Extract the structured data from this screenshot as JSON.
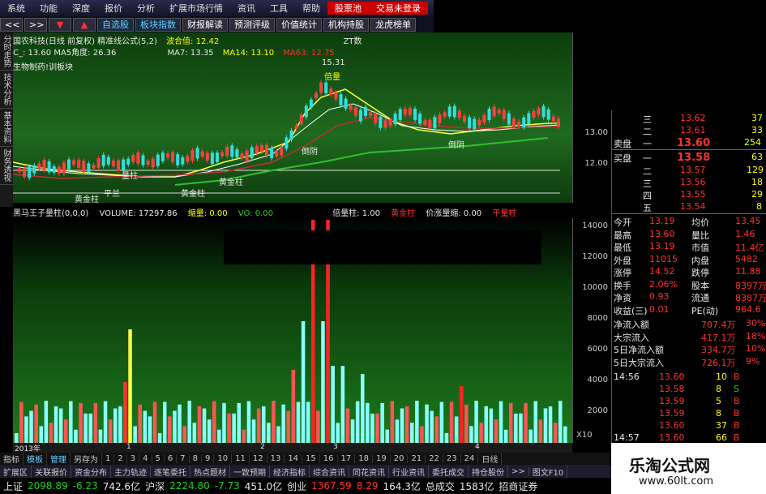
{
  "menu": [
    "系统",
    "功能",
    "深度",
    "报价",
    "分析",
    "扩展市场行情",
    "资讯",
    "工具",
    "帮助",
    "股票池",
    "交易未登录"
  ],
  "toolbar": {
    "back": "<<",
    "forward": ">>",
    "tabs": [
      "自选股",
      "板块指数",
      "财报解读",
      "预测评级",
      "价值统计",
      "机构持股",
      "龙虎榜单"
    ]
  },
  "vtabs": [
    "分时走势",
    "技术分析",
    "基本资料",
    "财务透视"
  ],
  "kline": {
    "title": "国农科技(日线 前复权) 精准线公式(5,2)",
    "wave": "波合值: 12.42",
    "line2": "C_: 13.60  MA5角度: 26.36",
    "ma": [
      "MA7: 13.35",
      "MA14: 13.10",
      "MA63: 12.75"
    ],
    "sector": "生物制药!训板块",
    "zt": "ZT数",
    "annotations": [
      "15.31",
      "倍量",
      "量柱",
      "黄金柱",
      "黄金柱",
      "黄金柱",
      "倒阴",
      "倒阴",
      "平兰"
    ],
    "axis": [
      "13.00",
      "12.00"
    ]
  },
  "vol": {
    "header": [
      "黑马王子量柱(0,0,0)",
      "VOLUME: 17297.86",
      "缩量: 0.00",
      "VO: 0.00",
      "倍量柱: 1.00",
      "黄金柱",
      "价涨量缩: 0.00",
      "平量柱"
    ],
    "axis": [
      "14000",
      "12000",
      "10000",
      "8000",
      "6000",
      "4000",
      "2000"
    ],
    "x10": "X10",
    "timebar": [
      "2013年",
      "1",
      "2",
      "3",
      "4"
    ]
  },
  "quote": {
    "sell": [
      {
        "label": "三",
        "price": "13.62",
        "vol": "37"
      },
      {
        "label": "二",
        "price": "13.61",
        "vol": "33"
      },
      {
        "label": "一",
        "price": "13.60",
        "vol": "254"
      }
    ],
    "sell_label": "卖盘",
    "buy_label": "买盘",
    "buy": [
      {
        "label": "一",
        "price": "13.58",
        "vol": "63"
      },
      {
        "label": "二",
        "price": "13.57",
        "vol": "129"
      },
      {
        "label": "三",
        "price": "13.56",
        "vol": "18"
      },
      {
        "label": "四",
        "price": "13.55",
        "vol": "29"
      },
      {
        "label": "五",
        "price": "13.54",
        "vol": "8"
      }
    ],
    "stats": [
      [
        "今开",
        "13.19",
        "均价",
        "13.45"
      ],
      [
        "最高",
        "13.60",
        "量比",
        "1.46"
      ],
      [
        "最低",
        "13.19",
        "市值",
        "11.4亿"
      ],
      [
        "外盘",
        "11015",
        "内盘",
        "5482"
      ],
      [
        "涨停",
        "14.52",
        "跌停",
        "11.88"
      ],
      [
        "换手",
        "2.06%",
        "股本",
        "8397万"
      ],
      [
        "净资",
        "0.93",
        "流通",
        "8387万"
      ],
      [
        "收益(三)",
        "0.01",
        "PE(动)",
        "964.6"
      ]
    ],
    "flows": [
      [
        "净流入额",
        "707.4万",
        "30%"
      ],
      [
        "大宗流入",
        "417.1万",
        "18%"
      ],
      [
        "5日净流入额",
        "334.7万",
        "10%"
      ],
      [
        "5日大宗流入",
        "726.1万",
        "9%"
      ]
    ],
    "ticks": [
      [
        "14:56",
        "13.60",
        "10",
        "B"
      ],
      [
        "",
        "13.58",
        "8",
        "S"
      ],
      [
        "",
        "13.59",
        "5",
        "B"
      ],
      [
        "",
        "13.59",
        "8",
        "B"
      ],
      [
        "",
        "13.60",
        "37",
        "B"
      ],
      [
        "14:57",
        "13.60",
        "66",
        "B"
      ]
    ]
  },
  "tabs1": [
    "指标",
    "模板",
    "管理",
    "另存为",
    "1",
    "2",
    "3",
    "4",
    "5",
    "6",
    "7",
    "8",
    "9",
    "10",
    "11",
    "12",
    "13",
    "14",
    "15",
    "16",
    "17",
    "18",
    "19",
    "20",
    "21",
    "22",
    "23",
    "24",
    "日线"
  ],
  "tabs2": [
    "扩展区",
    "关联报价",
    "资金分布",
    "主力轨迹",
    "逐笔委托",
    "热点题材",
    "一致预期",
    "经济指标",
    "综合资讯",
    "同花资讯",
    "行业资讯",
    "委托成交",
    "持仓股份",
    ">>",
    "图文F10"
  ],
  "ticker": [
    {
      "name": "上证",
      "value": "2098.89",
      "chg": "-6.23",
      "amt": "742.6亿"
    },
    {
      "name": "沪深",
      "value": "2224.80",
      "chg": "-7.73",
      "amt": "451.0亿"
    },
    {
      "name": "创业",
      "value": "1367.59",
      "chg": "8.29",
      "amt": "164.3亿"
    },
    {
      "name": "总成交",
      "value": "1583亿"
    },
    {
      "name": "招商证券"
    }
  ],
  "watermark": {
    "title": "乐淘公式网",
    "url": "www.60lt.com"
  }
}
